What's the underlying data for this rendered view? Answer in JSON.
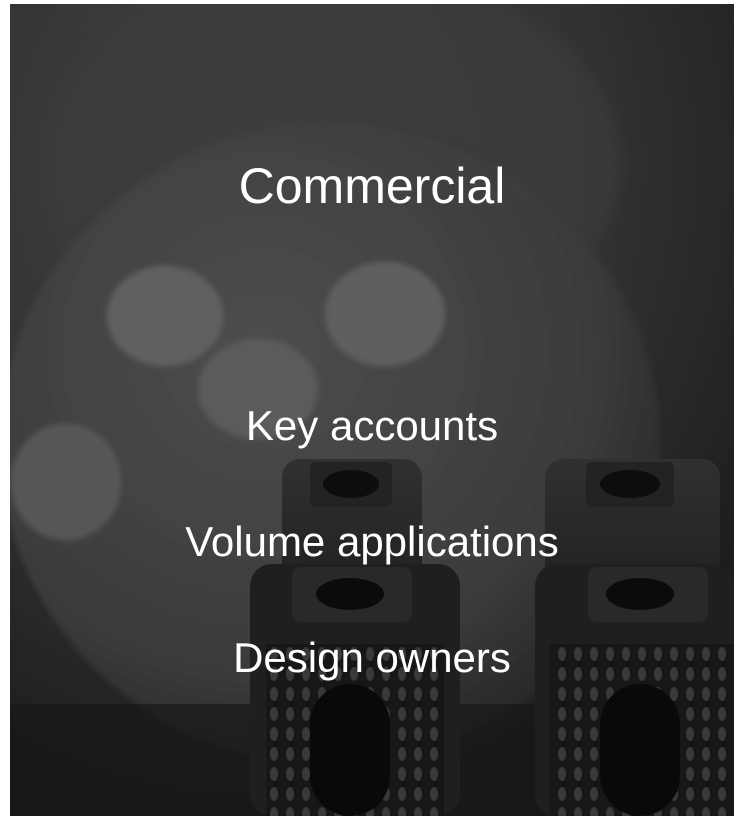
{
  "slide": {
    "title": "Commercial",
    "items": [
      "Key accounts",
      "Volume applications",
      "Design owners"
    ]
  },
  "colors": {
    "text": "#ffffff",
    "background": "#3a3a3a"
  }
}
